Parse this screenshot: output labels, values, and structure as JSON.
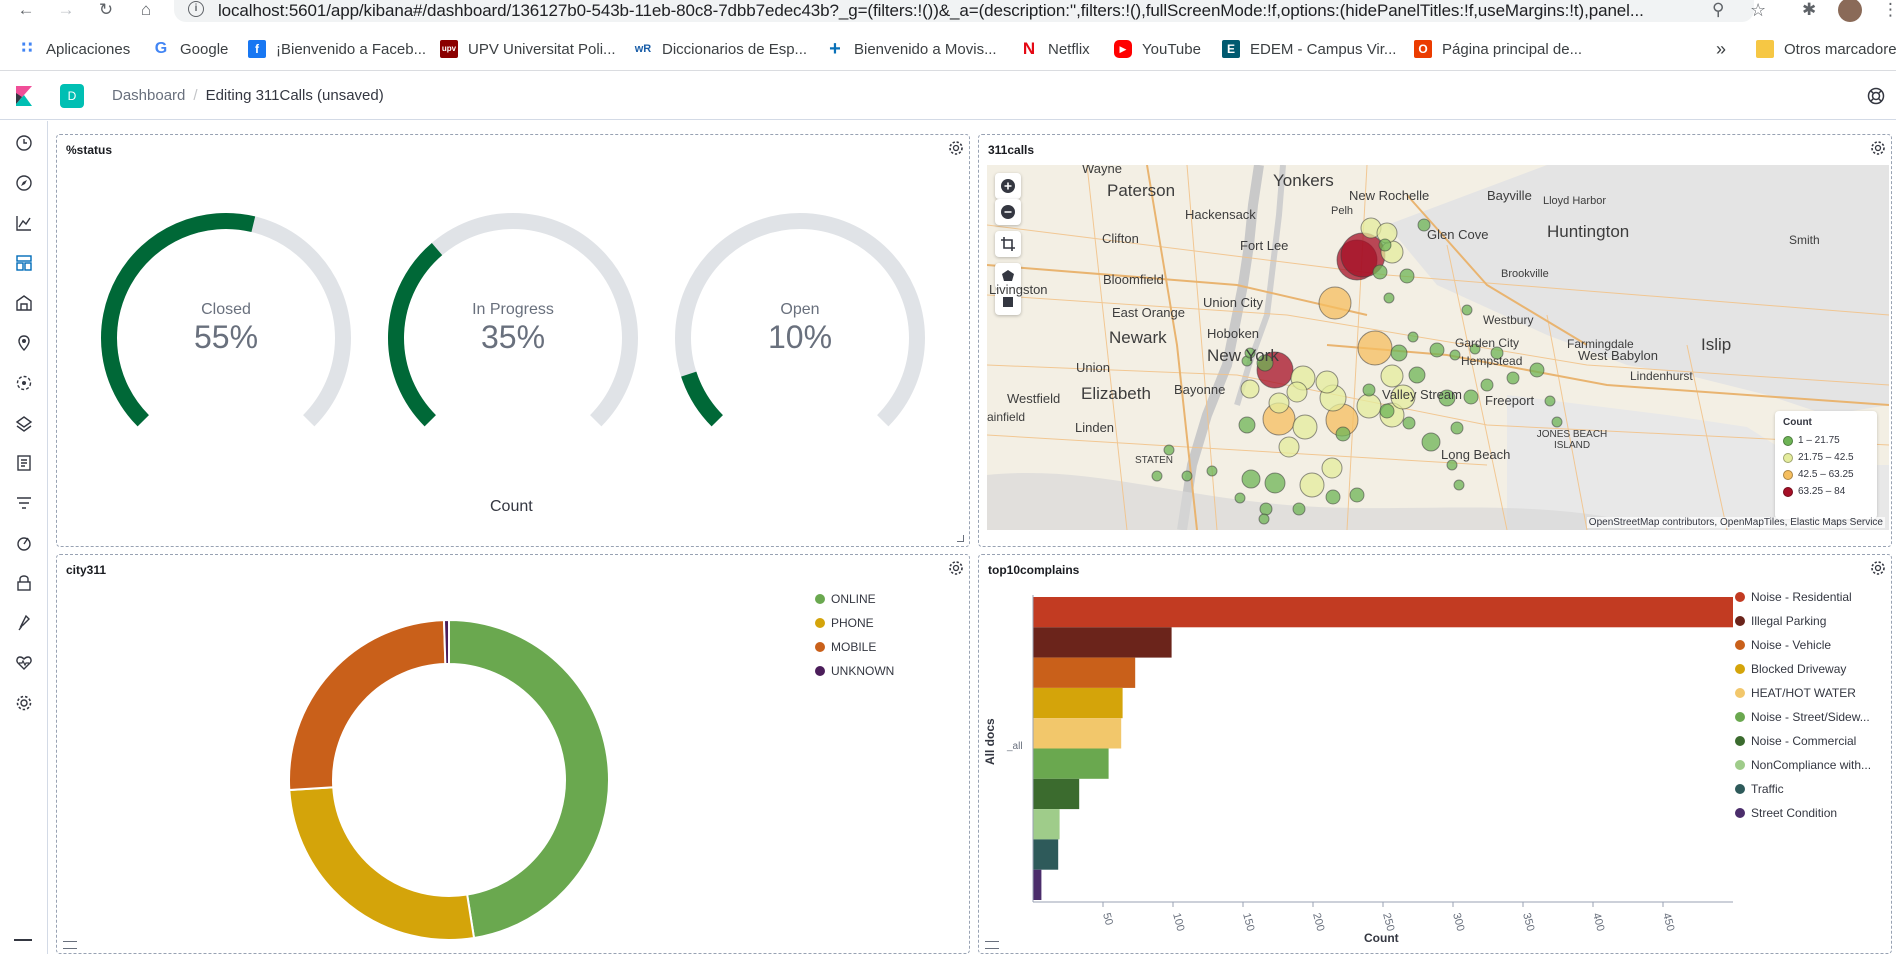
{
  "browser": {
    "url": "localhost:5601/app/kibana#/dashboard/136127b0-543b-11eb-80c8-7dbb7edec43b?_g=(filters:!())&_a=(description:'',filters:!(),fullScreenMode:!f,options:(hidePanelTitles:!f,useMargins:!t),panel...",
    "bookmarks": [
      {
        "label": "Aplicaciones",
        "icon": "apps-grid-icon",
        "color": "#4285f4"
      },
      {
        "label": "Google",
        "icon": "google-icon",
        "color": "#4285f4"
      },
      {
        "label": "¡Bienvenido a Faceb...",
        "icon": "facebook-icon",
        "color": "#1877f2"
      },
      {
        "label": "UPV Universitat Poli...",
        "icon": "upv-icon",
        "color": "#c00000"
      },
      {
        "label": "Diccionarios de Esp...",
        "icon": "wordreference-icon",
        "color": "#1a5ea8"
      },
      {
        "label": "Bienvenido a Movis...",
        "icon": "plus-icon",
        "color": "#0a71b8"
      },
      {
        "label": "Netflix",
        "icon": "netflix-icon",
        "color": "#e50914"
      },
      {
        "label": "YouTube",
        "icon": "youtube-icon",
        "color": "#ff0000"
      },
      {
        "label": "EDEM - Campus Vir...",
        "icon": "edem-icon",
        "color": "#005a70"
      },
      {
        "label": "Página principal de...",
        "icon": "office-icon",
        "color": "#eb3c00"
      }
    ],
    "more": "»",
    "other_bookmarks": "Otros marcadores"
  },
  "header": {
    "space_initial": "D",
    "breadcrumb_root": "Dashboard",
    "breadcrumb_current": "Editing 311Calls (unsaved)"
  },
  "panels": {
    "status": {
      "title": "%status",
      "count_label": "Count",
      "gauges": [
        {
          "label": "Closed",
          "value": "55%",
          "fraction": 0.55
        },
        {
          "label": "In Progress",
          "value": "35%",
          "fraction": 0.35
        },
        {
          "label": "Open",
          "value": "10%",
          "fraction": 0.1
        }
      ],
      "gauge_color": "#006837",
      "track_color": "#e0e3e7"
    },
    "map": {
      "title": "311calls",
      "legend_title": "Count",
      "legend": [
        {
          "label": "1 – 21.75",
          "color": "#6eb456"
        },
        {
          "label": "21.75 – 42.5",
          "color": "#e4ec9c"
        },
        {
          "label": "42.5 – 63.25",
          "color": "#f5be5f"
        },
        {
          "label": "63.25 – 84",
          "color": "#a50f26"
        }
      ],
      "attribution": "OpenStreetMap contributors, OpenMapTiles, Elastic Maps Service",
      "places": [
        "Wayne",
        "Paterson",
        "Yonkers",
        "New Rochelle",
        "Bayville",
        "Lloyd Harbor",
        "Hackensack",
        "Glen Cove",
        "Huntington",
        "Smith",
        "Clifton",
        "Fort Lee",
        "Bloomfield",
        "Livingston",
        "Brookville",
        "East Orange",
        "Union City",
        "Newark",
        "Hoboken",
        "New York",
        "Westbury",
        "Farmingdale",
        "Union",
        "Garden City",
        "Hempstead",
        "West Babylon",
        "Islip",
        "Westfield",
        "Elizabeth",
        "Bayonne",
        "Lindenhurst",
        "Valley Stream",
        "Freeport",
        "ainfield",
        "Linden",
        "STATEN",
        "Long Beach",
        "JONES BEACH ISLAND",
        "Pelh"
      ]
    },
    "city": {
      "title": "city311",
      "legend": [
        {
          "label": "ONLINE",
          "color": "#6aa84f"
        },
        {
          "label": "PHONE",
          "color": "#d4a40a"
        },
        {
          "label": "MOBILE",
          "color": "#c9601a"
        },
        {
          "label": "UNKNOWN",
          "color": "#4b1d5a"
        }
      ]
    },
    "top10": {
      "title": "top10complains",
      "ylabel": "All docs",
      "y_category": "_all",
      "xlabel": "Count",
      "legend": [
        {
          "label": "Noise - Residential",
          "color": "#c23b22"
        },
        {
          "label": "Illegal Parking",
          "color": "#6b241b"
        },
        {
          "label": "Noise - Vehicle",
          "color": "#c9601a"
        },
        {
          "label": "Blocked Driveway",
          "color": "#d4a40a"
        },
        {
          "label": "HEAT/HOT WATER",
          "color": "#f2c76b"
        },
        {
          "label": "Noise - Street/Sidew...",
          "color": "#6aa84f"
        },
        {
          "label": "Noise - Commercial",
          "color": "#3b6b2e"
        },
        {
          "label": "NonCompliance with...",
          "color": "#9fcc8a"
        },
        {
          "label": "Traffic",
          "color": "#2e5a5a"
        },
        {
          "label": "Street Condition",
          "color": "#4b2d6b"
        }
      ]
    }
  },
  "chart_data": [
    {
      "type": "pie",
      "title": "city311",
      "categories": [
        "ONLINE",
        "PHONE",
        "MOBILE",
        "UNKNOWN"
      ],
      "values": [
        47.5,
        26.5,
        25.5,
        0.5
      ],
      "donut": true,
      "legend": "top-right"
    },
    {
      "type": "bar",
      "orientation": "horizontal",
      "title": "top10complains",
      "categories": [
        "Noise - Residential",
        "Illegal Parking",
        "Noise - Vehicle",
        "Blocked Driveway",
        "HEAT/HOT WATER",
        "Noise - Street/Sidew...",
        "Noise - Commercial",
        "NonCompliance with...",
        "Traffic",
        "Street Condition"
      ],
      "values": [
        500,
        99,
        73,
        64,
        63,
        54,
        33,
        19,
        18,
        6
      ],
      "xlabel": "Count",
      "ylabel": "All docs",
      "xlim": [
        0,
        500
      ],
      "xticks": [
        50,
        100,
        150,
        200,
        250,
        300,
        350,
        400,
        450
      ],
      "legend": "right"
    }
  ]
}
